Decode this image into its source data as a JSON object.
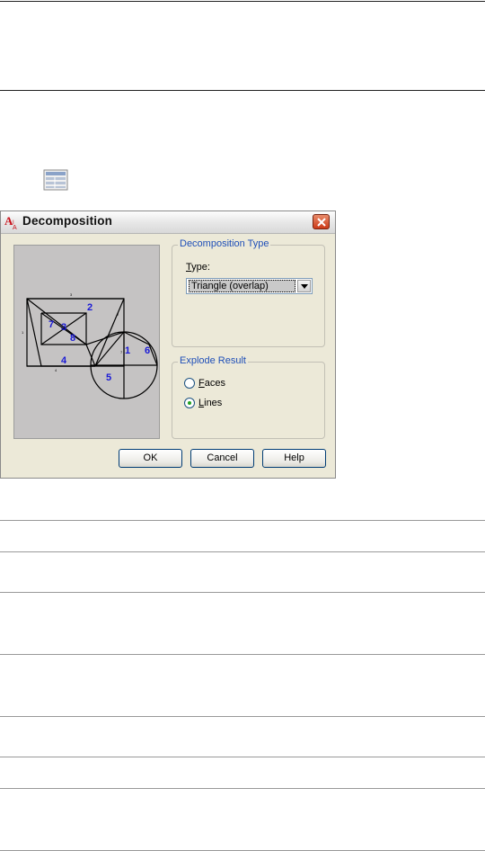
{
  "dialog": {
    "title": "Decomposition",
    "logo_text": "A",
    "icons": {
      "logo": "autocad-logo-icon",
      "close": "close-icon",
      "dropdown": "chevron-down-icon",
      "toolbar": "decomposition-toolbar-icon"
    },
    "preview": {
      "region_numbers": [
        "1",
        "2",
        "3",
        "4",
        "5",
        "6",
        "7",
        "8"
      ],
      "number_color": "#1a1ad6"
    },
    "decomposition_type": {
      "legend": "Decomposition Type",
      "type_label": "Type:",
      "type_access_key": "T",
      "type_label_rest": "ype:",
      "selected": "Triangle (overlap)"
    },
    "explode_result": {
      "legend": "Explode Result",
      "options": [
        {
          "label": "Faces",
          "access_key": "F",
          "rest": "aces",
          "selected": false
        },
        {
          "label": "Lines",
          "access_key": "L",
          "rest": "ines",
          "selected": true
        }
      ]
    },
    "buttons": {
      "ok": "OK",
      "cancel": "Cancel",
      "help": "Help"
    }
  },
  "colors": {
    "legend": "#1f4fb8",
    "dialog_bg": "#ece9d8",
    "preview_bg": "#c5c3c3"
  }
}
